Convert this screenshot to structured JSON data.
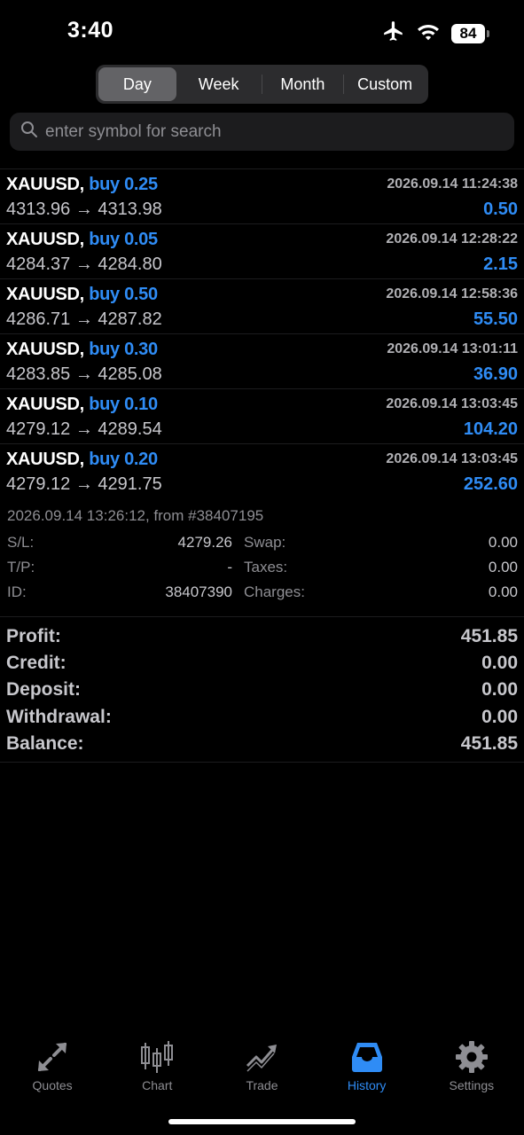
{
  "status": {
    "time": "3:40",
    "battery": "84"
  },
  "segments": [
    {
      "label": "Day",
      "active": true
    },
    {
      "label": "Week",
      "active": false
    },
    {
      "label": "Month",
      "active": false
    },
    {
      "label": "Custom",
      "active": false
    }
  ],
  "search": {
    "placeholder": "enter symbol for search",
    "value": ""
  },
  "deals": [
    {
      "symbol": "XAUUSD,",
      "side": "buy 0.25",
      "time": "2026.09.14 11:24:38",
      "prices": "4313.96 → 4313.98",
      "profit": "0.50"
    },
    {
      "symbol": "XAUUSD,",
      "side": "buy 0.05",
      "time": "2026.09.14 12:28:22",
      "prices": "4284.37 → 4284.80",
      "profit": "2.15"
    },
    {
      "symbol": "XAUUSD,",
      "side": "buy 0.50",
      "time": "2026.09.14 12:58:36",
      "prices": "4286.71 → 4287.82",
      "profit": "55.50"
    },
    {
      "symbol": "XAUUSD,",
      "side": "buy 0.30",
      "time": "2026.09.14 13:01:11",
      "prices": "4283.85 → 4285.08",
      "profit": "36.90"
    },
    {
      "symbol": "XAUUSD,",
      "side": "buy 0.10",
      "time": "2026.09.14 13:03:45",
      "prices": "4279.12 → 4289.54",
      "profit": "104.20"
    },
    {
      "symbol": "XAUUSD,",
      "side": "buy 0.20",
      "time": "2026.09.14 13:03:45",
      "prices": "4279.12 → 4291.75",
      "profit": "252.60"
    }
  ],
  "details": {
    "header": "2026.09.14 13:26:12, from #38407195",
    "sl_label": "S/L:",
    "sl_value": "4279.26",
    "tp_label": "T/P:",
    "tp_value": "-",
    "id_label": "ID:",
    "id_value": "38407390",
    "swap_label": "Swap:",
    "swap_value": "0.00",
    "taxes_label": "Taxes:",
    "taxes_value": "0.00",
    "charges_label": "Charges:",
    "charges_value": "0.00"
  },
  "summary": {
    "profit_label": "Profit:",
    "profit_value": "451.85",
    "credit_label": "Credit:",
    "credit_value": "0.00",
    "deposit_label": "Deposit:",
    "deposit_value": "0.00",
    "withdrawal_label": "Withdrawal:",
    "withdrawal_value": "0.00",
    "balance_label": "Balance:",
    "balance_value": "451.85"
  },
  "tabs": [
    {
      "label": "Quotes",
      "icon": "quotes-icon"
    },
    {
      "label": "Chart",
      "icon": "candlestick-icon"
    },
    {
      "label": "Trade",
      "icon": "trade-icon"
    },
    {
      "label": "History",
      "icon": "inbox-icon"
    },
    {
      "label": "Settings",
      "icon": "gear-icon"
    }
  ],
  "colors": {
    "accent": "#2f8cf5",
    "background": "#000000",
    "muted": "#8e8e93"
  }
}
